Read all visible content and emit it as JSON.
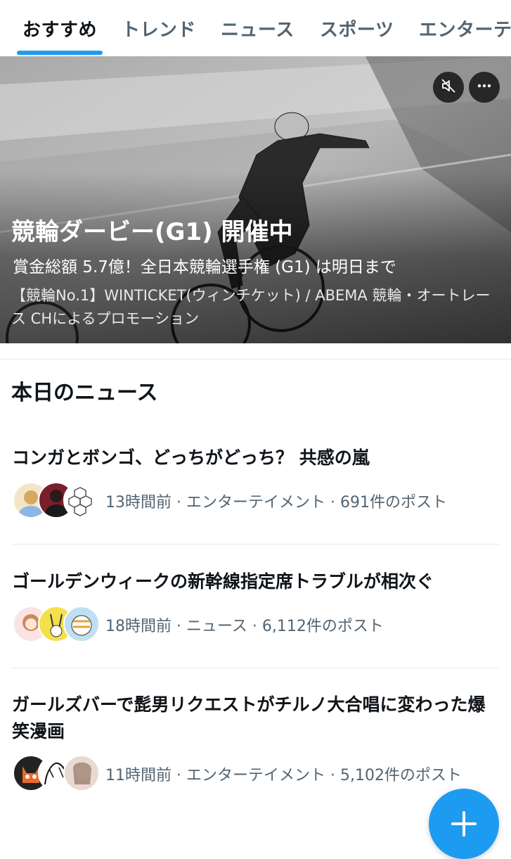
{
  "tabs": [
    {
      "label": "おすすめ",
      "active": true
    },
    {
      "label": "トレンド",
      "active": false
    },
    {
      "label": "ニュース",
      "active": false
    },
    {
      "label": "スポーツ",
      "active": false
    },
    {
      "label": "エンターテ",
      "active": false
    }
  ],
  "hero": {
    "title": "競輪ダービー(G1) 開催中",
    "subtitle": "賞金総額 5.7億！全日本競輪選手権 (G1) は明日まで",
    "promo": "【競輪No.1】WINTICKET(ウィンチケット) / ABEMA 競輪・オートレース CHによるプロモーション",
    "mute_icon": "speaker-muted-icon",
    "more_icon": "more-dots-icon"
  },
  "section": {
    "title": "本日のニュース"
  },
  "news": [
    {
      "title": "コンガとボンゴ、どっちがどっち？ 共感の嵐",
      "meta": "13時間前 · エンターテイメント · 691件のポスト"
    },
    {
      "title": "ゴールデンウィークの新幹線指定席トラブルが相次ぐ",
      "meta": "18時間前 · ニュース · 6,112件のポスト"
    },
    {
      "title": "ガールズバーで髭男リクエストがチルノ大合唱に変わった爆笑漫画",
      "meta": "11時間前 · エンターテイメント · 5,102件のポスト"
    }
  ],
  "fab": {
    "icon": "plus-icon"
  },
  "colors": {
    "accent": "#1d9bf0",
    "text_primary": "#0f1419",
    "text_secondary": "#536471",
    "divider": "#e6e9ec"
  }
}
